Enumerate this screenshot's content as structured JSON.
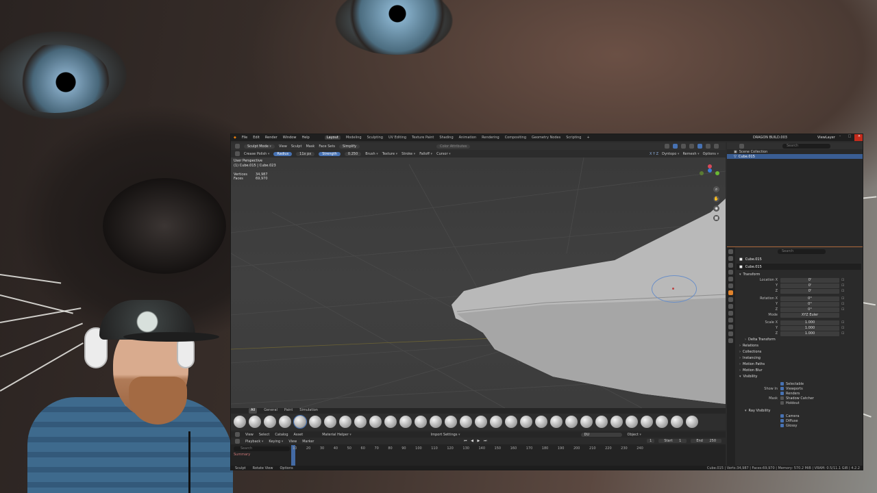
{
  "menu": [
    "File",
    "Edit",
    "Render",
    "Window",
    "Help"
  ],
  "workspaces": [
    "Layout",
    "Modeling",
    "Sculpting",
    "UV Editing",
    "Texture Paint",
    "Shading",
    "Animation",
    "Rendering",
    "Compositing",
    "Geometry Nodes",
    "Scripting",
    "+"
  ],
  "active_workspace": "Layout",
  "file_title": "DRAGON BUILD.003",
  "view_layer": "ViewLayer",
  "header1": {
    "mode": "Sculpt Mode",
    "items": [
      "View",
      "Sculpt",
      "Mask",
      "Face Sets"
    ],
    "simplify": "Simplify",
    "color_attributes": "Color Attributes"
  },
  "header2": {
    "brush": "Crease Polish",
    "radius_label": "Radius",
    "radius_value": "11x px",
    "strength_label": "Strength",
    "strength_value": "0.250",
    "menus": [
      "Brush",
      "Texture",
      "Stroke",
      "Falloff",
      "Cursor"
    ],
    "dyntopo": "Dyntopo",
    "remesh": "Remesh",
    "options": "Options"
  },
  "viewport": {
    "perspective": "User Perspective",
    "object": "(1) Cube.015 | Cube.023",
    "stats": [
      {
        "k": "Vertices",
        "v": "34,987"
      },
      {
        "k": "Faces",
        "v": "69,970"
      }
    ]
  },
  "toolshelf": [
    "All",
    "General",
    "Paint",
    "Simulation"
  ],
  "toolshelf_active": "All",
  "brush_count": 31,
  "assetbar": [
    "View",
    "Select",
    "Catalog",
    "Asset"
  ],
  "material_helper": "Material Helper",
  "import_settings": "Import Settings",
  "search_value": "DU",
  "object_label": "Object",
  "timeline": {
    "menus": [
      "Playback",
      "Keying",
      "View",
      "Marker"
    ],
    "start_label": "Start",
    "start": "1",
    "end_label": "End",
    "end": "250",
    "current": "1",
    "ticks": [
      "10",
      "20",
      "30",
      "40",
      "50",
      "60",
      "70",
      "80",
      "90",
      "100",
      "110",
      "120",
      "130",
      "140",
      "150",
      "160",
      "170",
      "180",
      "190",
      "200",
      "210",
      "220",
      "230",
      "240"
    ],
    "search_placeholder": "Search",
    "row": "Summary"
  },
  "statusbar": {
    "items": [
      "Sculpt",
      "Rotate View",
      "Options"
    ],
    "right": "Cube.015 | Verts:34,987 | Faces:69,970 | Memory: 570.2 MiB | VRAM: 0.5/11.1 GiB | 4.2.2"
  },
  "outliner": {
    "rows": [
      "Scene Collection",
      "Cube.015"
    ],
    "search_placeholder": "Search"
  },
  "properties": {
    "object": "Cube.015",
    "object_name": "Cube.015",
    "search_placeholder": "Search",
    "transform": "Transform",
    "location_x": "0'",
    "location_y": "0'",
    "location_z": "0'",
    "rotation_x": "0°",
    "rotation_y": "0°",
    "rotation_z": "0°",
    "mode_label": "Mode",
    "mode_value": "XYZ Euler",
    "scale_x": "1.000",
    "scale_y": "1.000",
    "scale_z": "1.000",
    "labels": {
      "location_x": "Location X",
      "rotation_x": "Rotation X",
      "scale_x": "Scale X",
      "y": "Y",
      "z": "Z"
    },
    "sections": [
      "Delta Transform",
      "Relations",
      "Collections",
      "Instancing",
      "Motion Paths",
      "Motion Blur",
      "Visibility"
    ],
    "visibility": {
      "selectable": "Selectable",
      "show_in": "Show In",
      "viewports": "Viewports",
      "renders": "Renders",
      "mask": "Mask",
      "shadow_catcher": "Shadow Catcher",
      "holdout": "Holdout"
    },
    "ray_visibility": "Ray Visibility",
    "ray_items": [
      "Camera",
      "Diffuse",
      "Glossy"
    ]
  },
  "colors": {
    "accent": "#4772b3",
    "header": "#303030",
    "close": "#c42b1c"
  }
}
